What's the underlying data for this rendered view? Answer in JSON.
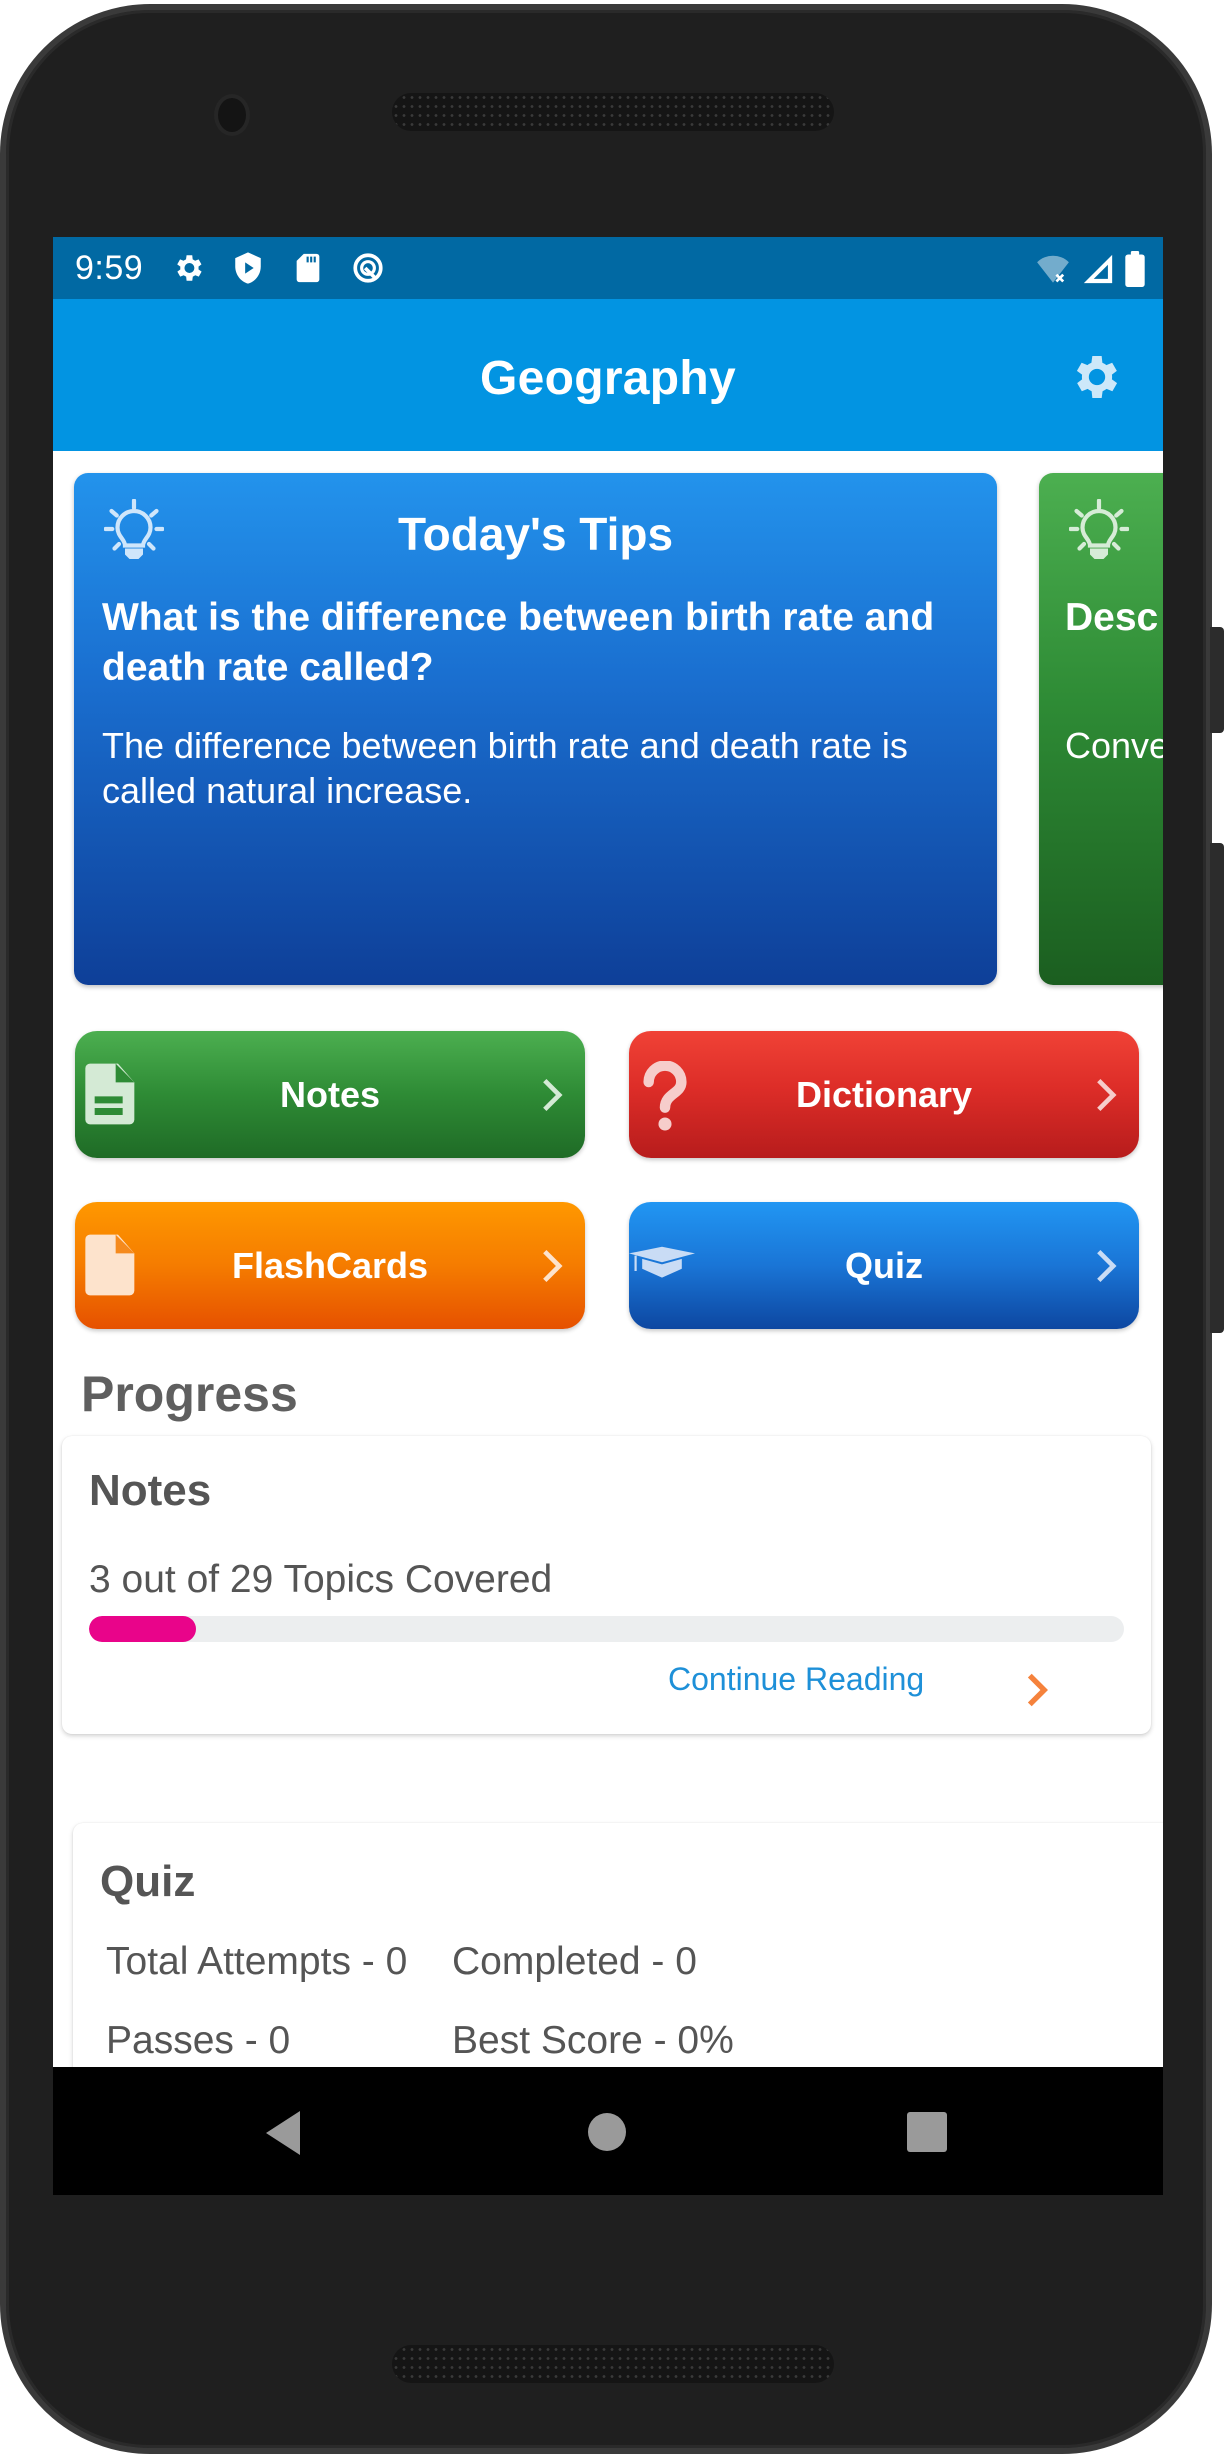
{
  "status_bar": {
    "time": "9:59",
    "left_icons": [
      "settings-icon",
      "play-protect-icon",
      "sd-card-icon",
      "android-q-icon"
    ],
    "right_icons": [
      "wifi-off-icon",
      "signal-icon",
      "battery-icon"
    ]
  },
  "app_bar": {
    "title": "Geography",
    "settings_icon": "gear-icon"
  },
  "tips": [
    {
      "heading": "Today's Tips",
      "question": "What is the difference between birth rate and death rate called?",
      "answer": "The difference between birth rate and death rate is called natural increase.",
      "color": "#1a6fd0"
    },
    {
      "heading": "Today's Tips",
      "question": "Desc destr",
      "answer": "Conve Dense contir",
      "color": "#2e8b35"
    }
  ],
  "nav_buttons": [
    {
      "label": "Notes",
      "icon": "document-icon",
      "color": "#2e8b35"
    },
    {
      "label": "Dictionary",
      "icon": "question-mark-icon",
      "color": "#dd2d28"
    },
    {
      "label": "FlashCards",
      "icon": "blank-page-icon",
      "color": "#f57c00"
    },
    {
      "label": "Quiz",
      "icon": "graduation-cap-icon",
      "color": "#1a75d6"
    }
  ],
  "progress": {
    "title": "Progress",
    "notes": {
      "title": "Notes",
      "covered_text": "3 out of 29 Topics Covered",
      "covered": 3,
      "total": 29,
      "fraction": 0.103,
      "bar_color": "#e9048a",
      "link_label": "Continue Reading",
      "link_color": "#1e90d8",
      "chevron_color": "#f5823c"
    },
    "quiz": {
      "title": "Quiz",
      "stats": [
        "Total Attempts - 0",
        "Completed - 0",
        "Passes - 0",
        "Best Score - 0%"
      ]
    }
  },
  "system_nav": [
    "back-icon",
    "home-icon",
    "recents-icon"
  ]
}
